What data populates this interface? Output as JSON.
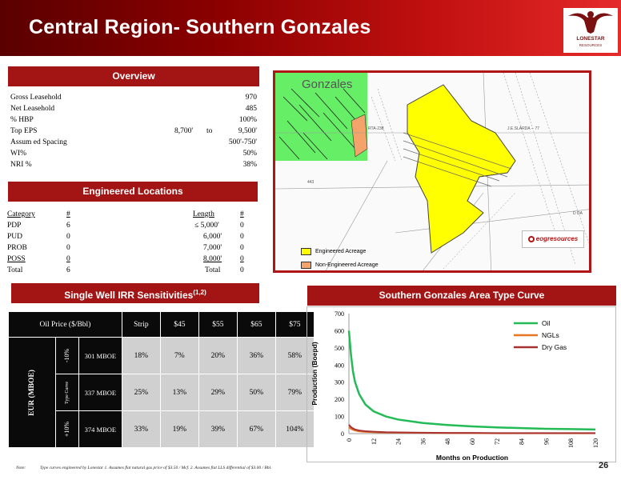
{
  "header": {
    "title": "Central Region- Southern Gonzales",
    "logo_name": "LONESTAR",
    "logo_sub": "RESOURCES"
  },
  "overview": {
    "title": "Overview",
    "rows": [
      {
        "label": "Gross Leasehold",
        "value": "970"
      },
      {
        "label": "Net Leasehold",
        "value": "485"
      },
      {
        "label": "% HBP",
        "value": "100%"
      },
      {
        "label": "Top EPS",
        "low": "8,700'",
        "to": "to",
        "high": "9,500'"
      },
      {
        "label": "Assum ed Spacing",
        "value": "500'-750'"
      },
      {
        "label": "WI%",
        "value": "50%"
      },
      {
        "label": "NRI %",
        "value": "38%"
      }
    ]
  },
  "locations": {
    "title": "Engineered Locations",
    "header": {
      "category": "Category",
      "count": "#",
      "length": "Length",
      "count2": "#"
    },
    "rows": [
      {
        "category": "PDP",
        "count": "6",
        "length": "≤ 5,000'",
        "count2": "0"
      },
      {
        "category": "PUD",
        "count": "0",
        "length": "6,000'",
        "count2": "0"
      },
      {
        "category": "PROB",
        "count": "0",
        "length": "7,000'",
        "count2": "0"
      },
      {
        "category": "POSS",
        "count": "0",
        "length": "8,000'",
        "count2": "0"
      },
      {
        "category": "Total",
        "count": "6",
        "length": "Total",
        "count2": "0"
      }
    ]
  },
  "irr": {
    "title": "Single Well IRR Sensitivities",
    "title_sup": "(1,2)",
    "header": [
      "Oil Price ($/Bbl)",
      "Strip",
      "$45",
      "$55",
      "$65",
      "$75"
    ],
    "eur_label": "EUR (MBOE)",
    "rows": [
      {
        "sens": "-10%",
        "eur": "301 MBOE",
        "values": [
          "18%",
          "7%",
          "20%",
          "36%",
          "58%"
        ]
      },
      {
        "sens": "Type Curve",
        "eur": "337 MBOE",
        "values": [
          "25%",
          "13%",
          "29%",
          "50%",
          "79%"
        ]
      },
      {
        "sens": "+10%",
        "eur": "374 MBOE",
        "values": [
          "33%",
          "19%",
          "39%",
          "67%",
          "104%"
        ]
      }
    ]
  },
  "map": {
    "title": "Gonzales",
    "legend": [
      "Engineered Acreage",
      "Non-Engineered Acreage"
    ],
    "company": "eogresources",
    "labels": [
      "RTA-238",
      "J.E.SLARDA -- 77",
      "443",
      "D DA"
    ],
    "colors": {
      "engineered": "#ffff00",
      "non_engineered": "#f4a46a",
      "green": "#66ee66"
    }
  },
  "chart_section": {
    "title": "Southern Gonzales Area Type Curve"
  },
  "chart_data": {
    "type": "line",
    "title": "",
    "xlabel": "Months on Production",
    "ylabel": "Production (Boepd)",
    "xlim": [
      0,
      120
    ],
    "ylim": [
      0,
      700
    ],
    "yticks": [
      0,
      100,
      200,
      300,
      400,
      500,
      600,
      700
    ],
    "xticks": [
      0,
      12,
      24,
      36,
      48,
      60,
      72,
      84,
      96,
      108,
      120
    ],
    "xtick_labels": [
      "0",
      "12",
      "24",
      "36",
      "48",
      "60",
      "72",
      "84",
      "96",
      "108",
      "120"
    ],
    "legend_position": "top-right",
    "series": [
      {
        "name": "Oil",
        "color": "#22bb55",
        "x": [
          0,
          1,
          2,
          3,
          5,
          8,
          12,
          18,
          24,
          36,
          48,
          60,
          72,
          84,
          96,
          108,
          120
        ],
        "y": [
          600,
          460,
          360,
          300,
          230,
          170,
          130,
          100,
          82,
          62,
          50,
          42,
          36,
          32,
          28,
          26,
          24
        ]
      },
      {
        "name": "NGLs",
        "color": "#e87722",
        "x": [
          0,
          1,
          2,
          3,
          5,
          8,
          12,
          18,
          24,
          36,
          48,
          60,
          72,
          84,
          96,
          108,
          120
        ],
        "y": [
          38,
          28,
          22,
          18,
          13,
          10,
          8,
          6,
          5,
          4,
          3,
          3,
          2,
          2,
          2,
          2,
          2
        ]
      },
      {
        "name": "Dry Gas",
        "color": "#a83232",
        "x": [
          0,
          1,
          2,
          3,
          5,
          8,
          12,
          18,
          24,
          36,
          48,
          60,
          72,
          84,
          96,
          108,
          120
        ],
        "y": [
          52,
          38,
          30,
          24,
          18,
          14,
          11,
          8,
          7,
          5,
          4,
          4,
          3,
          3,
          3,
          3,
          3
        ]
      }
    ]
  },
  "footer": {
    "note_label": "Note:",
    "note_text": "Type curves engineered by Lonestar 1. Assumes flat natural gas price of $3.50 / Mcf. 2. Assumes flat LLS differential of $3.00 / Bbl.",
    "page": "26"
  }
}
